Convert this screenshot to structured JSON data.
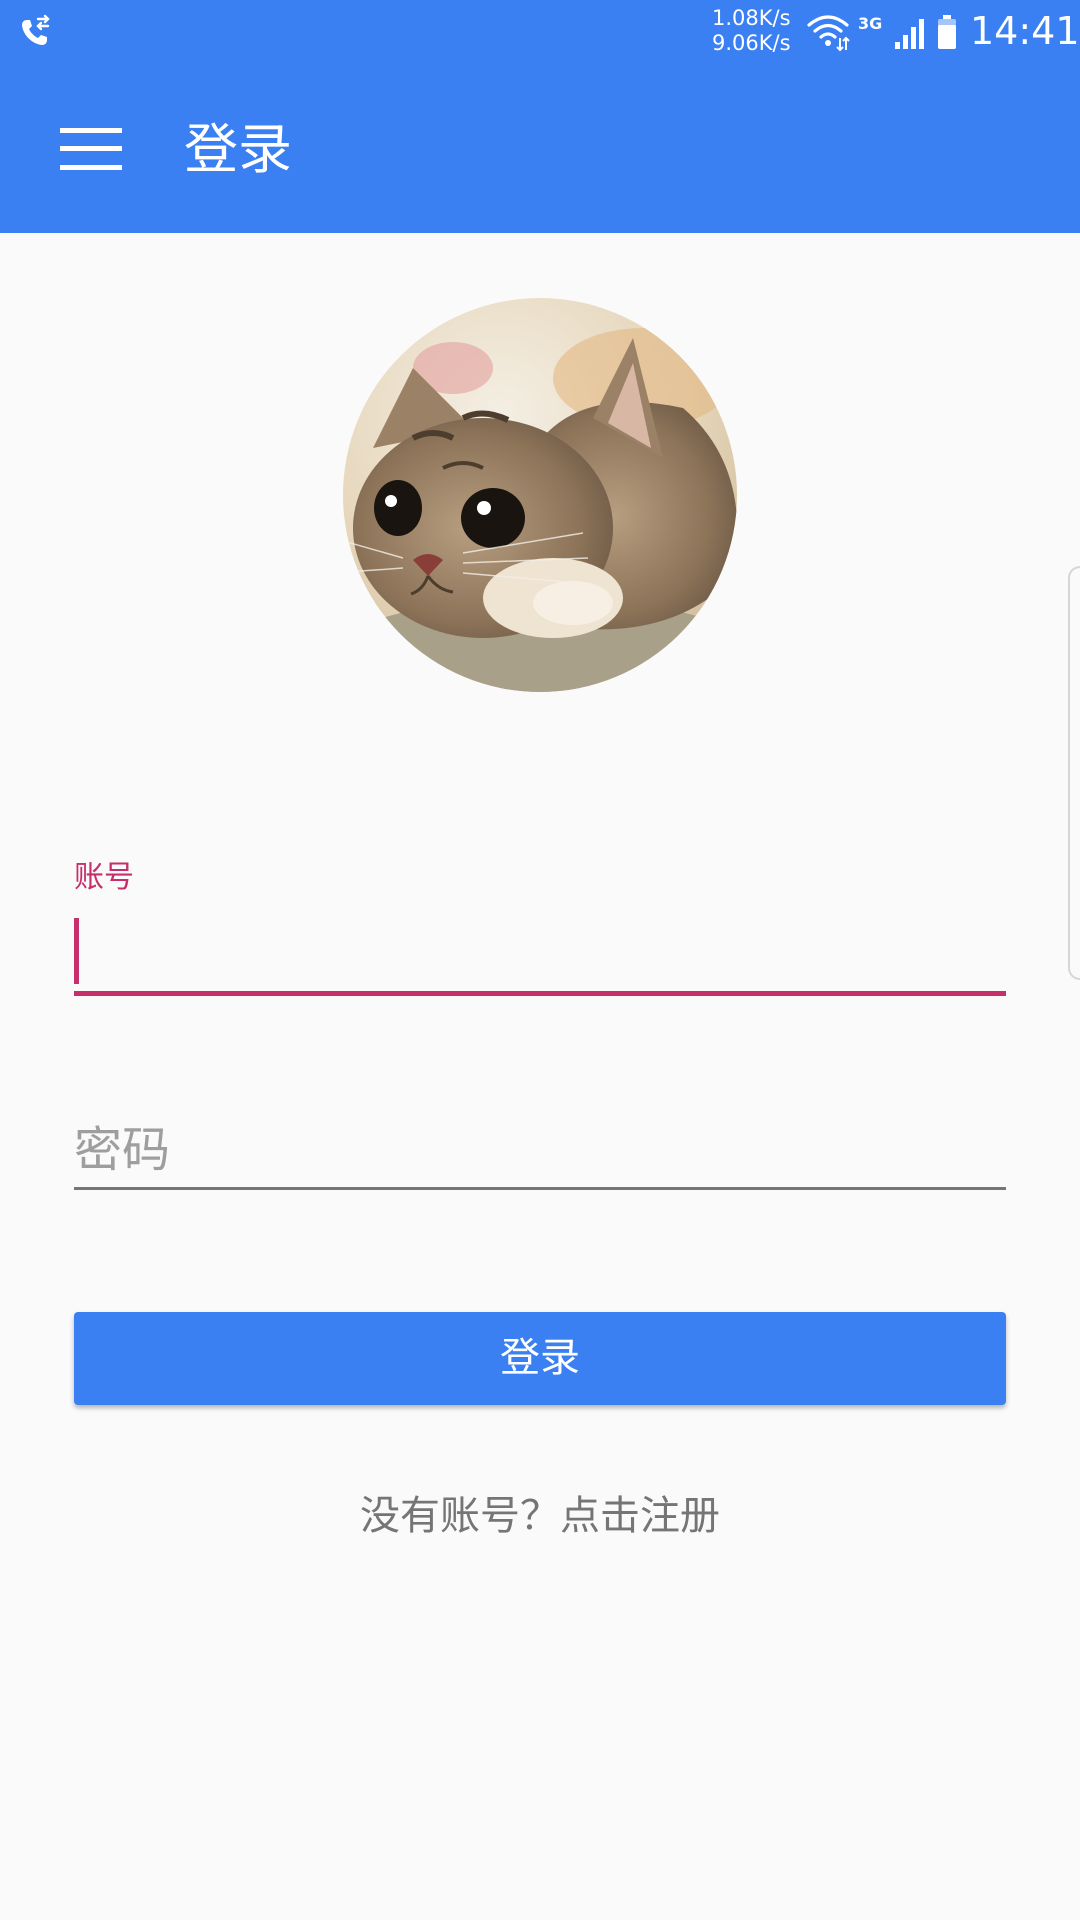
{
  "status_bar": {
    "network_speed_up": "1.08K/s",
    "network_speed_down": "9.06K/s",
    "network_type": "3G",
    "time": "14:41",
    "icons": [
      "call-forwarding-icon",
      "wifi-icon",
      "signal-icon",
      "battery-icon"
    ]
  },
  "app_bar": {
    "menu_icon": "hamburger-menu-icon",
    "title": "登录",
    "color": "#3a80f2"
  },
  "avatar": {
    "description_icon": "kitten-avatar"
  },
  "form": {
    "account_label": "账号",
    "account_value": "",
    "password_placeholder": "密码",
    "password_value": "",
    "accent_color": "#c72f6b"
  },
  "actions": {
    "login_label": "登录",
    "register_link": "没有账号？点击注册"
  }
}
